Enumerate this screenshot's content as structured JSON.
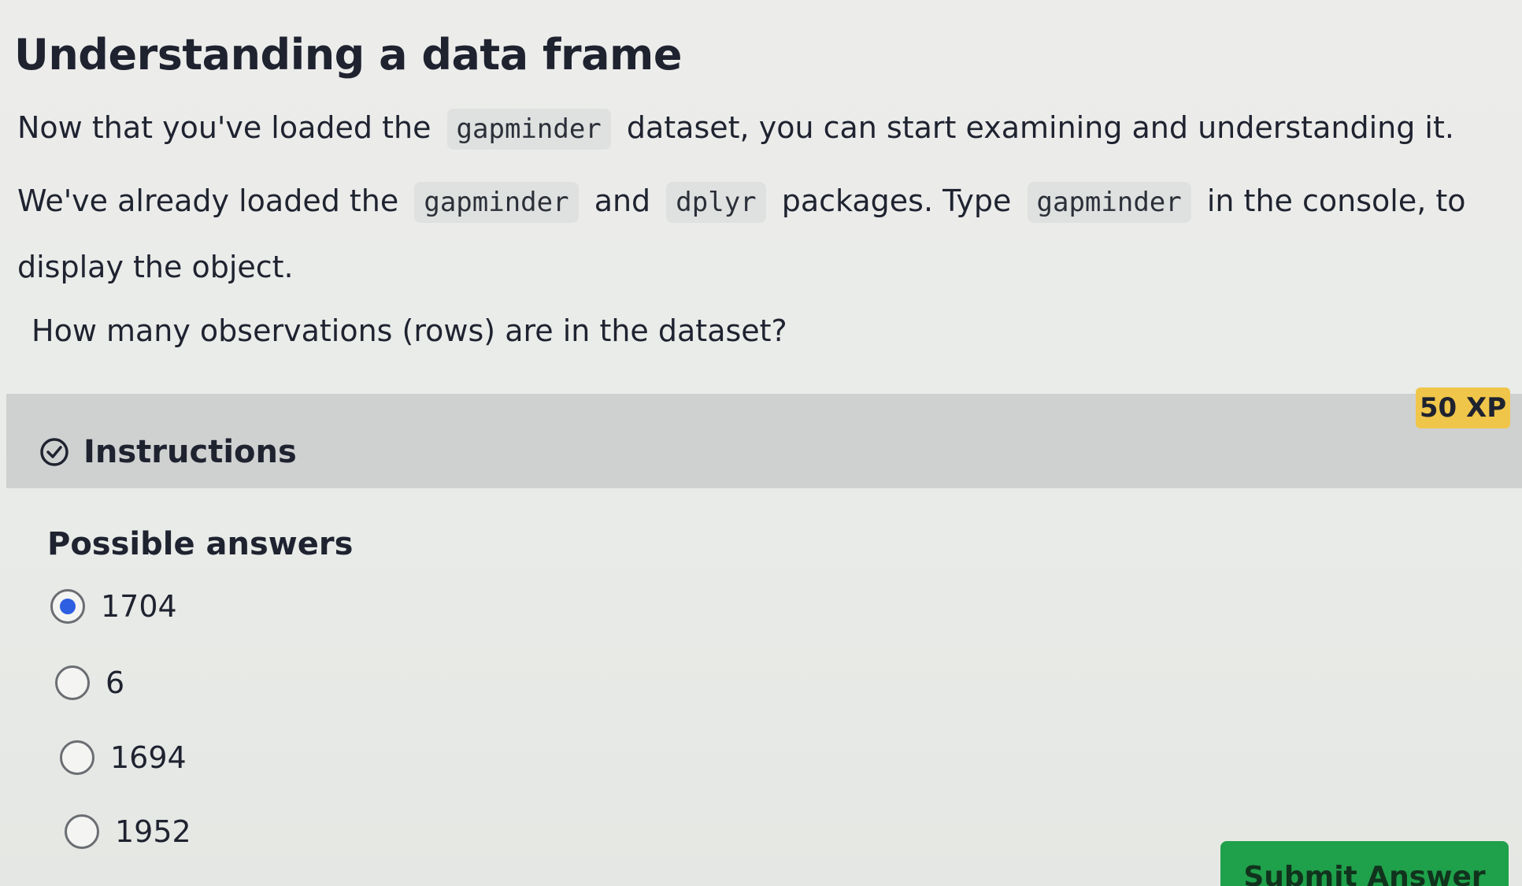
{
  "exercise": {
    "title": "Understanding a data frame",
    "para1": {
      "before": "Now that you've loaded the",
      "code": "gapminder",
      "after": "dataset, you can start examining and understanding it."
    },
    "para2": {
      "part1": "We've already loaded the",
      "code1": "gapminder",
      "part2": "and",
      "code2": "dplyr",
      "part3": "packages. Type",
      "code3": "gapminder",
      "part4": "in the console, to display the object."
    },
    "question": "How many observations (rows) are in the dataset?"
  },
  "instructions": {
    "label": "Instructions",
    "xp": "50 XP"
  },
  "answers": {
    "heading": "Possible answers",
    "options": [
      {
        "label": "1704",
        "selected": true
      },
      {
        "label": "6",
        "selected": false
      },
      {
        "label": "1694",
        "selected": false
      },
      {
        "label": "1952",
        "selected": false
      }
    ]
  },
  "submit": {
    "label": "Submit Answer"
  },
  "colors": {
    "accent_blue": "#2d5fe0",
    "xp_yellow": "#f0c64a",
    "submit_green": "#1fa04a"
  }
}
